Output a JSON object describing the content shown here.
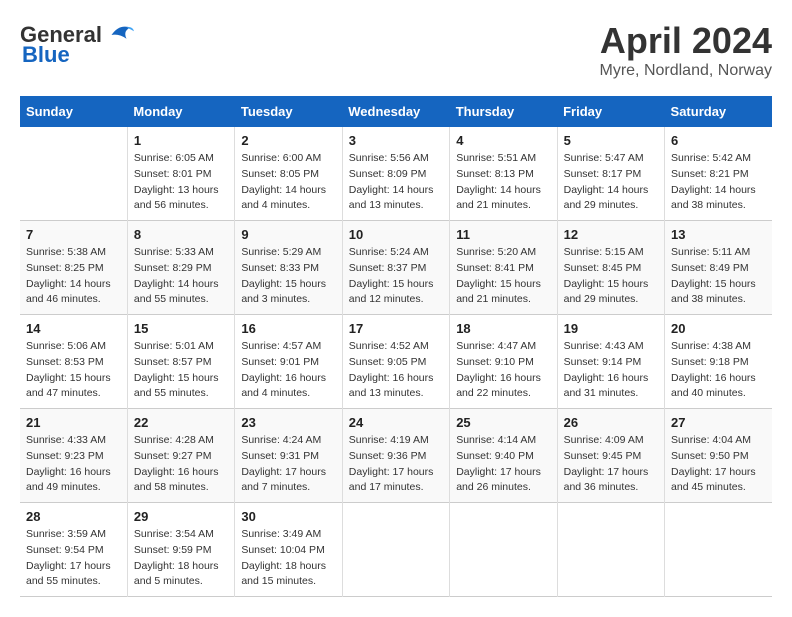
{
  "header": {
    "logo_general": "General",
    "logo_blue": "Blue",
    "month": "April 2024",
    "location": "Myre, Nordland, Norway"
  },
  "days_of_week": [
    "Sunday",
    "Monday",
    "Tuesday",
    "Wednesday",
    "Thursday",
    "Friday",
    "Saturday"
  ],
  "weeks": [
    [
      {
        "day": "",
        "info": ""
      },
      {
        "day": "1",
        "info": "Sunrise: 6:05 AM\nSunset: 8:01 PM\nDaylight: 13 hours\nand 56 minutes."
      },
      {
        "day": "2",
        "info": "Sunrise: 6:00 AM\nSunset: 8:05 PM\nDaylight: 14 hours\nand 4 minutes."
      },
      {
        "day": "3",
        "info": "Sunrise: 5:56 AM\nSunset: 8:09 PM\nDaylight: 14 hours\nand 13 minutes."
      },
      {
        "day": "4",
        "info": "Sunrise: 5:51 AM\nSunset: 8:13 PM\nDaylight: 14 hours\nand 21 minutes."
      },
      {
        "day": "5",
        "info": "Sunrise: 5:47 AM\nSunset: 8:17 PM\nDaylight: 14 hours\nand 29 minutes."
      },
      {
        "day": "6",
        "info": "Sunrise: 5:42 AM\nSunset: 8:21 PM\nDaylight: 14 hours\nand 38 minutes."
      }
    ],
    [
      {
        "day": "7",
        "info": "Sunrise: 5:38 AM\nSunset: 8:25 PM\nDaylight: 14 hours\nand 46 minutes."
      },
      {
        "day": "8",
        "info": "Sunrise: 5:33 AM\nSunset: 8:29 PM\nDaylight: 14 hours\nand 55 minutes."
      },
      {
        "day": "9",
        "info": "Sunrise: 5:29 AM\nSunset: 8:33 PM\nDaylight: 15 hours\nand 3 minutes."
      },
      {
        "day": "10",
        "info": "Sunrise: 5:24 AM\nSunset: 8:37 PM\nDaylight: 15 hours\nand 12 minutes."
      },
      {
        "day": "11",
        "info": "Sunrise: 5:20 AM\nSunset: 8:41 PM\nDaylight: 15 hours\nand 21 minutes."
      },
      {
        "day": "12",
        "info": "Sunrise: 5:15 AM\nSunset: 8:45 PM\nDaylight: 15 hours\nand 29 minutes."
      },
      {
        "day": "13",
        "info": "Sunrise: 5:11 AM\nSunset: 8:49 PM\nDaylight: 15 hours\nand 38 minutes."
      }
    ],
    [
      {
        "day": "14",
        "info": "Sunrise: 5:06 AM\nSunset: 8:53 PM\nDaylight: 15 hours\nand 47 minutes."
      },
      {
        "day": "15",
        "info": "Sunrise: 5:01 AM\nSunset: 8:57 PM\nDaylight: 15 hours\nand 55 minutes."
      },
      {
        "day": "16",
        "info": "Sunrise: 4:57 AM\nSunset: 9:01 PM\nDaylight: 16 hours\nand 4 minutes."
      },
      {
        "day": "17",
        "info": "Sunrise: 4:52 AM\nSunset: 9:05 PM\nDaylight: 16 hours\nand 13 minutes."
      },
      {
        "day": "18",
        "info": "Sunrise: 4:47 AM\nSunset: 9:10 PM\nDaylight: 16 hours\nand 22 minutes."
      },
      {
        "day": "19",
        "info": "Sunrise: 4:43 AM\nSunset: 9:14 PM\nDaylight: 16 hours\nand 31 minutes."
      },
      {
        "day": "20",
        "info": "Sunrise: 4:38 AM\nSunset: 9:18 PM\nDaylight: 16 hours\nand 40 minutes."
      }
    ],
    [
      {
        "day": "21",
        "info": "Sunrise: 4:33 AM\nSunset: 9:23 PM\nDaylight: 16 hours\nand 49 minutes."
      },
      {
        "day": "22",
        "info": "Sunrise: 4:28 AM\nSunset: 9:27 PM\nDaylight: 16 hours\nand 58 minutes."
      },
      {
        "day": "23",
        "info": "Sunrise: 4:24 AM\nSunset: 9:31 PM\nDaylight: 17 hours\nand 7 minutes."
      },
      {
        "day": "24",
        "info": "Sunrise: 4:19 AM\nSunset: 9:36 PM\nDaylight: 17 hours\nand 17 minutes."
      },
      {
        "day": "25",
        "info": "Sunrise: 4:14 AM\nSunset: 9:40 PM\nDaylight: 17 hours\nand 26 minutes."
      },
      {
        "day": "26",
        "info": "Sunrise: 4:09 AM\nSunset: 9:45 PM\nDaylight: 17 hours\nand 36 minutes."
      },
      {
        "day": "27",
        "info": "Sunrise: 4:04 AM\nSunset: 9:50 PM\nDaylight: 17 hours\nand 45 minutes."
      }
    ],
    [
      {
        "day": "28",
        "info": "Sunrise: 3:59 AM\nSunset: 9:54 PM\nDaylight: 17 hours\nand 55 minutes."
      },
      {
        "day": "29",
        "info": "Sunrise: 3:54 AM\nSunset: 9:59 PM\nDaylight: 18 hours\nand 5 minutes."
      },
      {
        "day": "30",
        "info": "Sunrise: 3:49 AM\nSunset: 10:04 PM\nDaylight: 18 hours\nand 15 minutes."
      },
      {
        "day": "",
        "info": ""
      },
      {
        "day": "",
        "info": ""
      },
      {
        "day": "",
        "info": ""
      },
      {
        "day": "",
        "info": ""
      }
    ]
  ]
}
